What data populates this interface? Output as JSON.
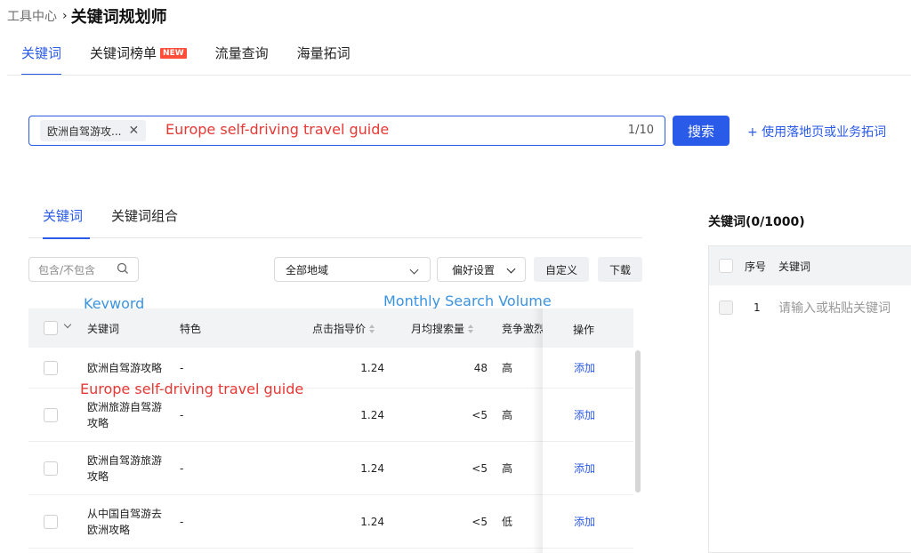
{
  "breadcrumb": {
    "parent": "工具中心",
    "current": "关键词规划师"
  },
  "top_tabs": [
    {
      "label": "关键词",
      "badge": ""
    },
    {
      "label": "关键词榜单",
      "badge": "NEW"
    },
    {
      "label": "流量查询",
      "badge": ""
    },
    {
      "label": "海量拓词",
      "badge": ""
    }
  ],
  "search": {
    "tag": "欧洲自驾游攻...",
    "annotation": "Europe self-driving travel guide",
    "counter": "1/10",
    "button": "搜索",
    "landing_link": "+ 使用落地页或业务拓词"
  },
  "inner_tabs": [
    {
      "label": "关键词"
    },
    {
      "label": "关键词组合"
    }
  ],
  "filters": {
    "include_placeholder": "包含/不包含",
    "region": "全部地域",
    "preference": "偏好设置",
    "customize": "自定义",
    "download": "下载"
  },
  "annotations": {
    "keyword": "Keyword",
    "monthly_volume": "Monthly Search Volume",
    "row_translation": "Europe self-driving travel guide"
  },
  "table": {
    "headers": {
      "keyword": "关键词",
      "feature": "特色",
      "cpc": "点击指导价",
      "volume": "月均搜索量",
      "competition": "竞争激烈",
      "action": "操作"
    },
    "rows": [
      {
        "keyword_l1": "欧洲自驾游攻略",
        "keyword_l2": "",
        "feature": "-",
        "cpc": "1.24",
        "volume": "48",
        "competition": "高",
        "action": "添加"
      },
      {
        "keyword_l1": "欧洲旅游自驾游",
        "keyword_l2": "攻略",
        "feature": "-",
        "cpc": "1.24",
        "volume": "<5",
        "competition": "高",
        "action": "添加"
      },
      {
        "keyword_l1": "欧洲自驾游旅游",
        "keyword_l2": "攻略",
        "feature": "-",
        "cpc": "1.24",
        "volume": "<5",
        "competition": "高",
        "action": "添加"
      },
      {
        "keyword_l1": "从中国自驾游去",
        "keyword_l2": "欧洲攻略",
        "feature": "-",
        "cpc": "1.24",
        "volume": "<5",
        "competition": "低",
        "action": "添加"
      }
    ]
  },
  "right_panel": {
    "title": "关键词(0/1000)",
    "headers": {
      "index": "序号",
      "keyword": "关键词"
    },
    "row": {
      "index": "1",
      "placeholder": "请输入或粘贴关键词"
    }
  },
  "colors": {
    "accent": "#2a5ae8",
    "annotation_red": "#e53935",
    "annotation_blue": "#3b93e0",
    "new_badge": "#ff4d3a"
  }
}
